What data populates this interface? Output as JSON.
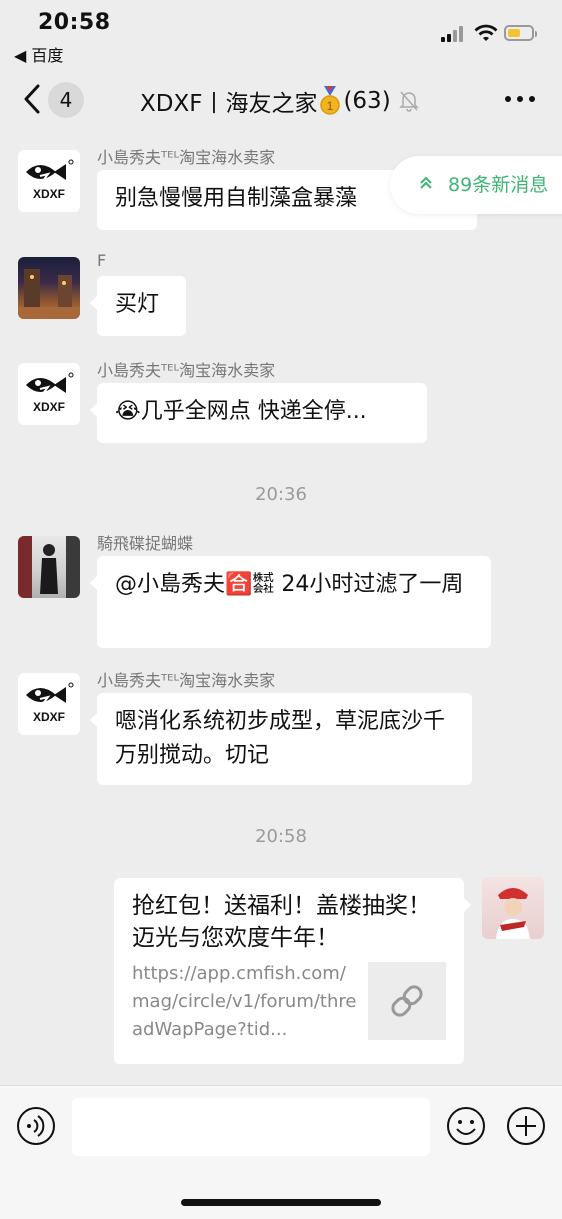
{
  "status_bar": {
    "time": "20:58",
    "back_app": "◀ 百度"
  },
  "nav": {
    "unread_badge": "4",
    "title": "XDXF丨海友之家",
    "member_count": "(63)"
  },
  "new_messages_button": "89条新消息",
  "messages": [
    {
      "sender": "小島秀夫ᵀᴱᴸ淘宝海水卖家",
      "text": "别急慢慢用自制藻盒暴藻"
    },
    {
      "sender": "F",
      "text": "买灯"
    },
    {
      "sender": "小島秀夫ᵀᴱᴸ淘宝海水卖家",
      "text": "😭几乎全网点 快递全停..."
    },
    {
      "sender": "騎飛碟捉蝴蝶",
      "text": "@小島秀夫🈴㍿ 24小时过滤了一周"
    },
    {
      "sender": "小島秀夫ᵀᴱᴸ淘宝海水卖家",
      "text": "嗯消化系统初步成型，草泥底沙千万别搅动。切记"
    }
  ],
  "timestamps": [
    "20:36",
    "20:58"
  ],
  "link_card": {
    "title": "抢红包！送福利！盖楼抽奖！迈光与您欢度牛年！",
    "url": "https://app.cmfish.com/mag/circle/v1/forum/threadWapPage?tid..."
  },
  "logo_text": "XDXF",
  "input": {
    "placeholder": ""
  },
  "colors": {
    "background": "#ededed",
    "accent_green": "#3eb575",
    "bubble": "#ffffff"
  }
}
